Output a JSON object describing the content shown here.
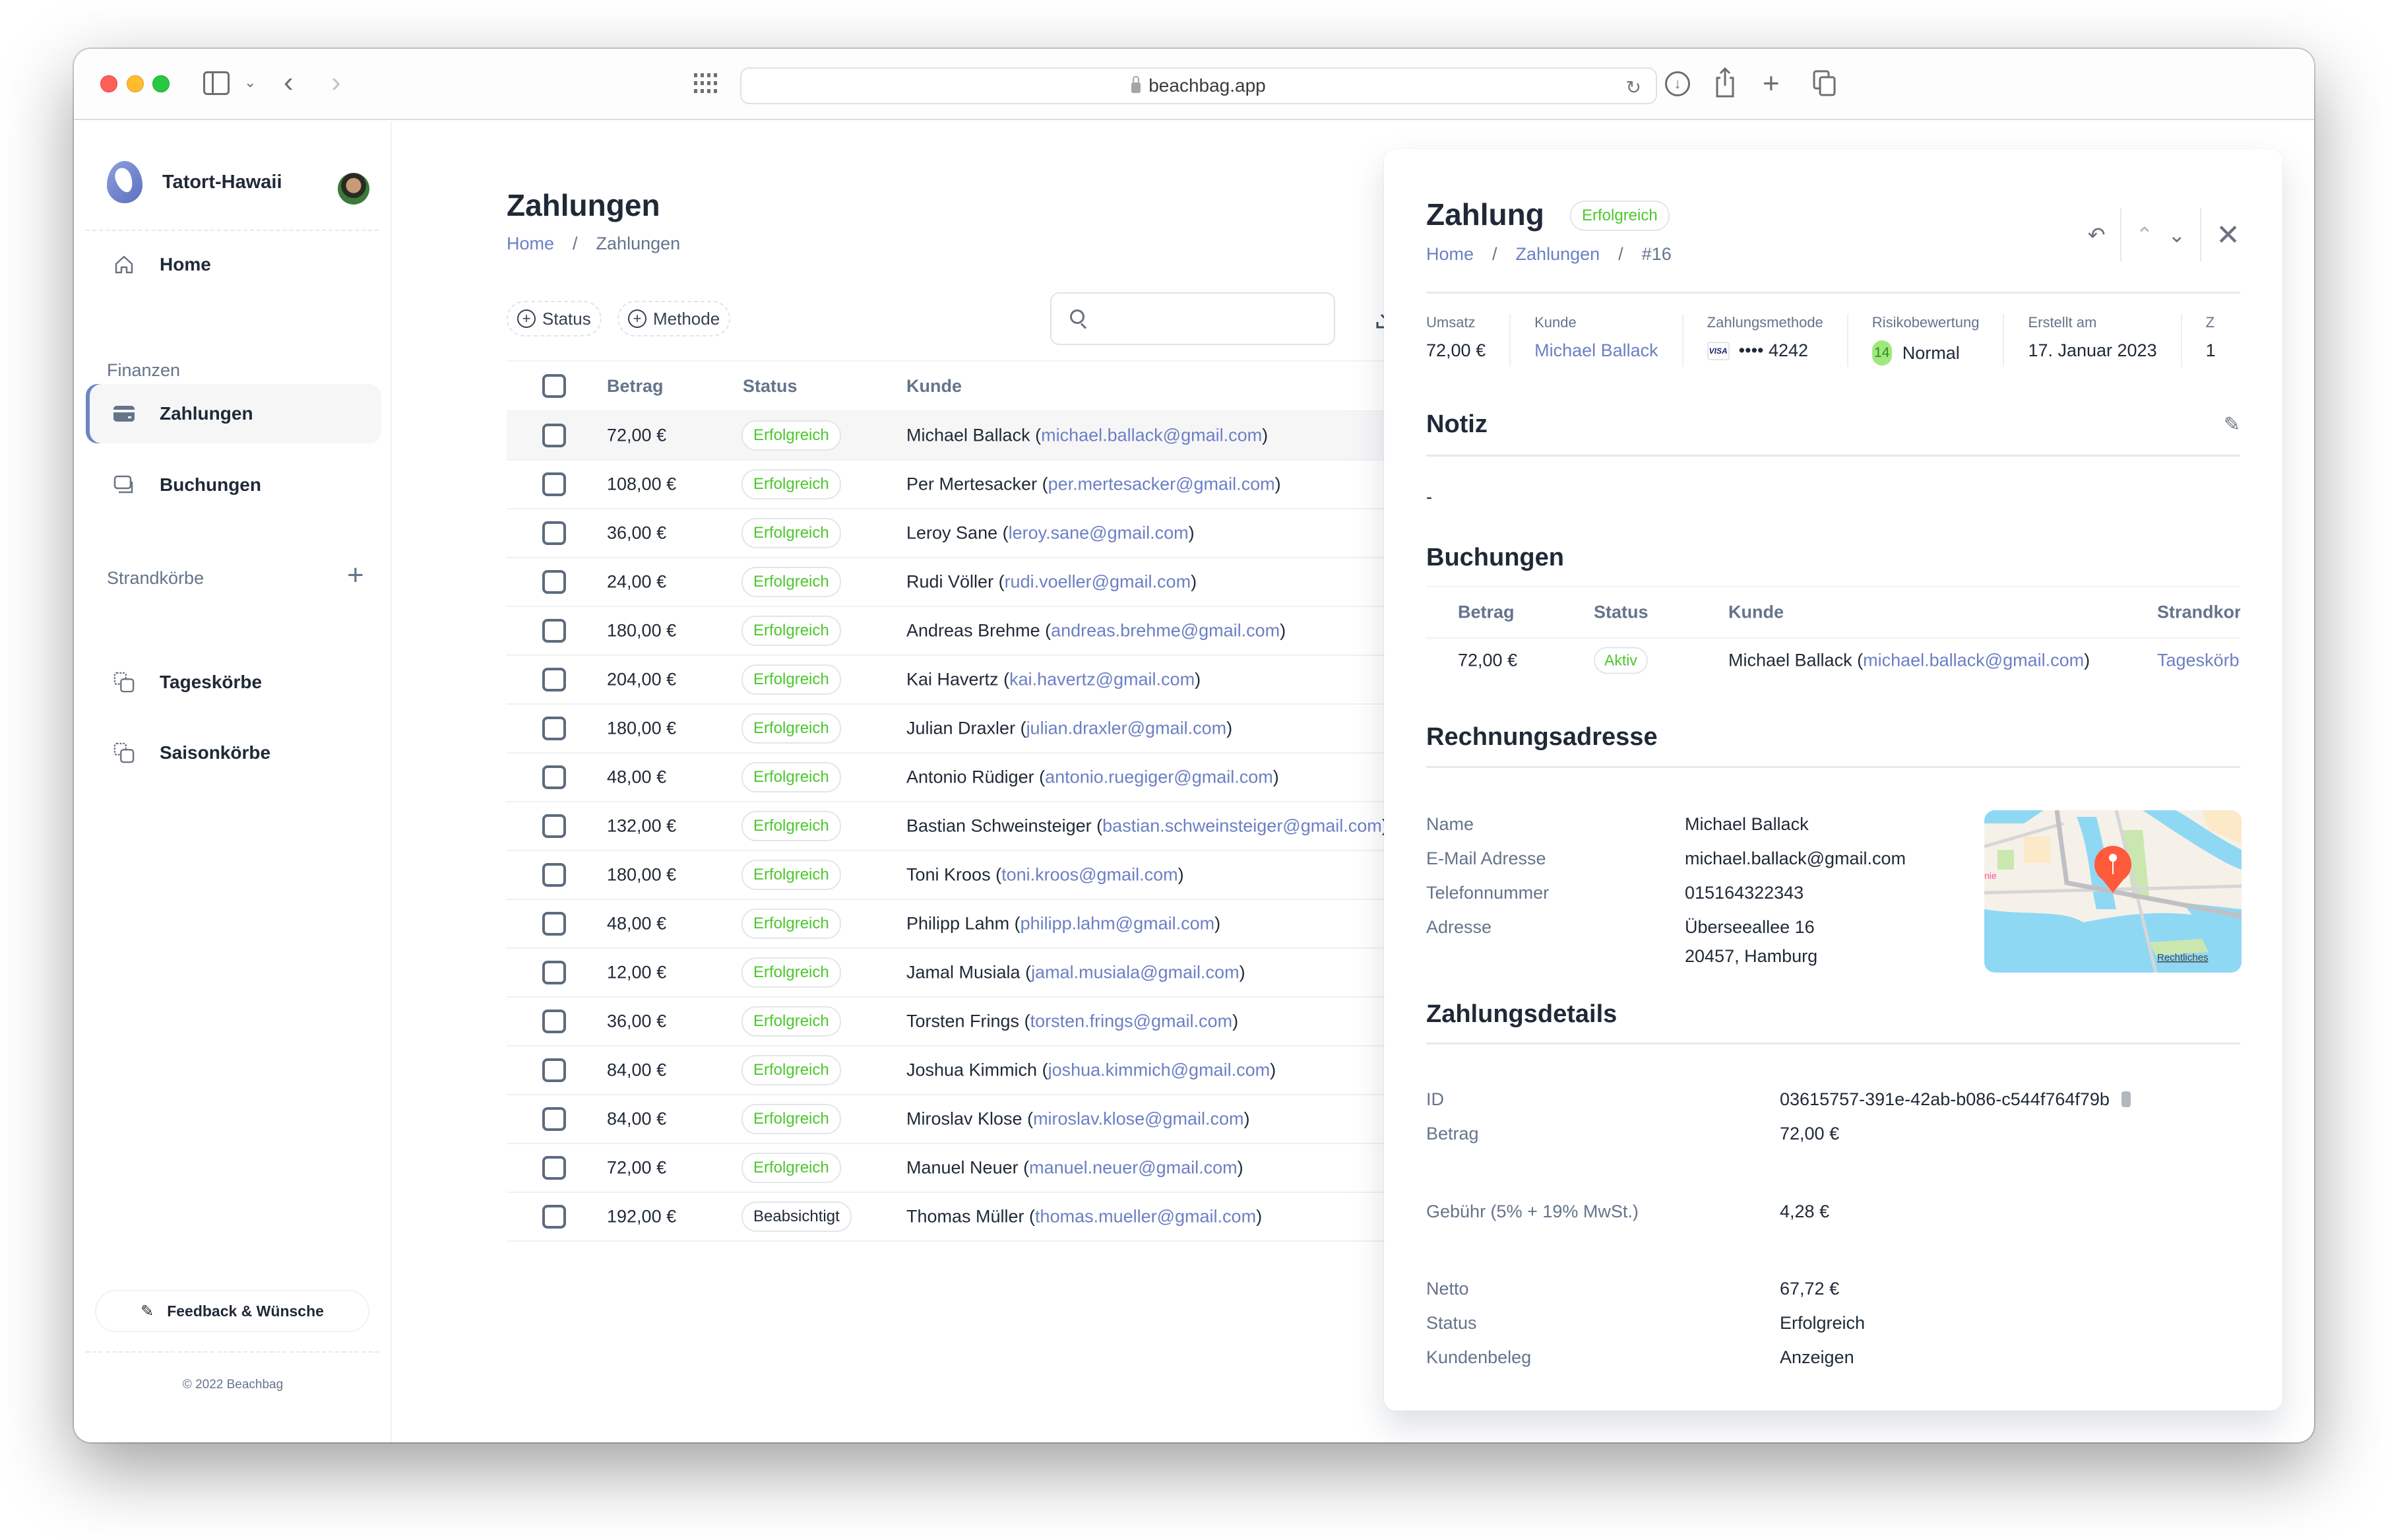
{
  "browser": {
    "url": "beachbag.app",
    "icons": [
      "close-window",
      "minimize-window",
      "zoom-window",
      "sidebar-toggle-icon",
      "chevron-down-icon",
      "back-icon",
      "forward-icon",
      "grid-icon",
      "reload-icon",
      "download-icon",
      "share-icon",
      "new-tab-icon",
      "tabs-overview-icon"
    ]
  },
  "sidebar": {
    "workspace": "Tatort-Hawaii",
    "home": "Home",
    "section_finance": "Finanzen",
    "section_beachchairs": "Strandkörbe",
    "items": [
      {
        "label": "Zahlungen",
        "icon": "credit-card-icon",
        "active": true
      },
      {
        "label": "Buchungen",
        "icon": "bookings-icon",
        "active": false
      },
      {
        "label": "Tageskörbe",
        "icon": "copy-icon",
        "active": false
      },
      {
        "label": "Saisonkörbe",
        "icon": "copy-icon",
        "active": false
      }
    ],
    "feedback": "Feedback & Wünsche",
    "copyright": "© 2022 Beachbag"
  },
  "main": {
    "title": "Zahlungen",
    "breadcrumb": [
      "Home",
      "/",
      "Zahlungen"
    ],
    "filters": [
      "Status",
      "Methode"
    ],
    "search": {
      "placeholder": "",
      "value": ""
    },
    "columns": [
      "Betrag",
      "Status",
      "Kunde"
    ],
    "rows": [
      {
        "amount": "72,00 €",
        "status": "Erfolgreich",
        "name": "Michael Ballack",
        "email": "michael.ballack@gmail.com",
        "selected": true
      },
      {
        "amount": "108,00 €",
        "status": "Erfolgreich",
        "name": "Per Mertesacker",
        "email": "per.mertesacker@gmail.com"
      },
      {
        "amount": "36,00 €",
        "status": "Erfolgreich",
        "name": "Leroy Sane",
        "email": "leroy.sane@gmail.com"
      },
      {
        "amount": "24,00 €",
        "status": "Erfolgreich",
        "name": "Rudi Völler",
        "email": "rudi.voeller@gmail.com"
      },
      {
        "amount": "180,00 €",
        "status": "Erfolgreich",
        "name": "Andreas Brehme",
        "email": "andreas.brehme@gmail.com"
      },
      {
        "amount": "204,00 €",
        "status": "Erfolgreich",
        "name": "Kai Havertz",
        "email": "kai.havertz@gmail.com"
      },
      {
        "amount": "180,00 €",
        "status": "Erfolgreich",
        "name": "Julian Draxler",
        "email": "julian.draxler@gmail.com"
      },
      {
        "amount": "48,00 €",
        "status": "Erfolgreich",
        "name": "Antonio Rüdiger",
        "email": "antonio.ruegiger@gmail.com"
      },
      {
        "amount": "132,00 €",
        "status": "Erfolgreich",
        "name": "Bastian Schweinsteiger",
        "email": "bastian.schweinsteiger@gmail.com"
      },
      {
        "amount": "180,00 €",
        "status": "Erfolgreich",
        "name": "Toni Kroos",
        "email": "toni.kroos@gmail.com"
      },
      {
        "amount": "48,00 €",
        "status": "Erfolgreich",
        "name": "Philipp Lahm",
        "email": "philipp.lahm@gmail.com"
      },
      {
        "amount": "12,00 €",
        "status": "Erfolgreich",
        "name": "Jamal Musiala",
        "email": "jamal.musiala@gmail.com"
      },
      {
        "amount": "36,00 €",
        "status": "Erfolgreich",
        "name": "Torsten Frings",
        "email": "torsten.frings@gmail.com"
      },
      {
        "amount": "84,00 €",
        "status": "Erfolgreich",
        "name": "Joshua Kimmich",
        "email": "joshua.kimmich@gmail.com"
      },
      {
        "amount": "84,00 €",
        "status": "Erfolgreich",
        "name": "Miroslav Klose",
        "email": "miroslav.klose@gmail.com"
      },
      {
        "amount": "72,00 €",
        "status": "Erfolgreich",
        "name": "Manuel Neuer",
        "email": "manuel.neuer@gmail.com"
      },
      {
        "amount": "192,00 €",
        "status": "Beabsichtigt",
        "name": "Thomas Müller",
        "email": "thomas.mueller@gmail.com"
      }
    ]
  },
  "detail": {
    "title": "Zahlung",
    "status_badge": "Erfolgreich",
    "breadcrumb": [
      "Home",
      "/",
      "Zahlungen",
      "/",
      "#16"
    ],
    "kpis": [
      {
        "label": "Umsatz",
        "value": "72,00 €"
      },
      {
        "label": "Kunde",
        "value": "Michael Ballack"
      },
      {
        "label": "Zahlungsmethode",
        "brand": "VISA",
        "value": "•••• 4242"
      },
      {
        "label": "Risikobewertung",
        "score": "14",
        "value": "Normal"
      },
      {
        "label": "Erstellt am",
        "value": "17. Januar 2023"
      },
      {
        "label": "Z",
        "value": "1"
      }
    ],
    "note": {
      "title": "Notiz",
      "text": "-"
    },
    "bookings": {
      "title": "Buchungen",
      "columns": [
        "Betrag",
        "Status",
        "Kunde",
        "Strandkorb"
      ],
      "columns_visible": [
        "Betrag",
        "Status",
        "Kunde",
        "Strandkor"
      ],
      "rows": [
        {
          "amount": "72,00 €",
          "status": "Aktiv",
          "name": "Michael Ballack",
          "email": "michael.ballack@gmail.com",
          "beachchair": "Tageskörb"
        }
      ]
    },
    "billing": {
      "title": "Rechnungsadresse",
      "fields": [
        {
          "label": "Name",
          "value": "Michael Ballack"
        },
        {
          "label": "E-Mail Adresse",
          "value": "michael.ballack@gmail.com"
        },
        {
          "label": "Telefonnummer",
          "value": "015164322343"
        },
        {
          "label": "Adresse",
          "value": "Überseeallee 16",
          "value2": "20457, Hamburg"
        }
      ],
      "map_legal": "Rechtliches",
      "map_label": "nie"
    },
    "payment": {
      "title": "Zahlungsdetails",
      "fields": [
        {
          "label": "ID",
          "value": "03615757-391e-42ab-b086-c544f764f79b"
        },
        {
          "label": "Betrag",
          "value": "72,00 €"
        },
        {
          "label": "Gebühr (5% + 19% MwSt.)",
          "value": "4,28 €"
        },
        {
          "label": "Netto",
          "value": "67,72 €"
        },
        {
          "label": "Status",
          "value": "Erfolgreich"
        },
        {
          "label": "Kundenbeleg",
          "value": "Anzeigen"
        }
      ]
    }
  },
  "colors": {
    "accent": "#6b7fc4",
    "success": "#4cc72c",
    "text": "#1f2937",
    "muted": "#64748b",
    "risk_badge": "#9ee87e",
    "map_pin": "#ff5a3c"
  }
}
